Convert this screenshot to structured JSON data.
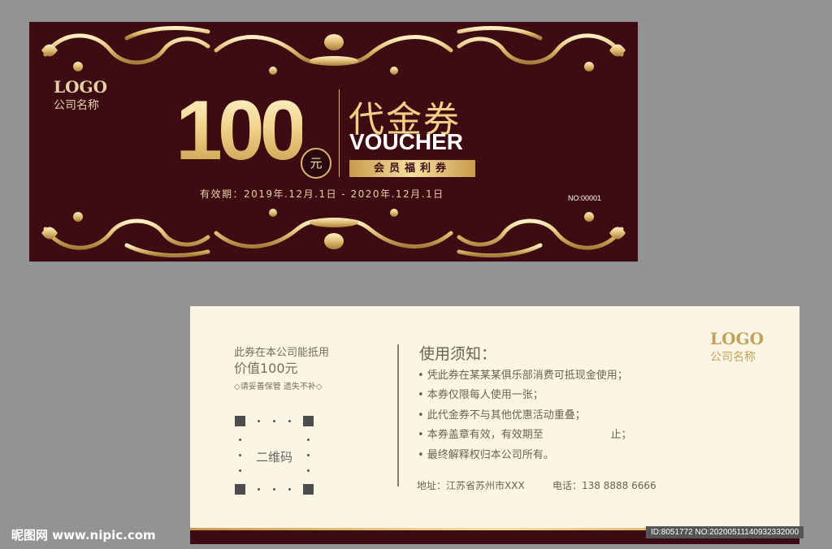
{
  "front": {
    "logo": "LOGO",
    "company": "公司名称",
    "amount": "100",
    "currency": "元",
    "title_cn": "代金券",
    "title_en": "VOUCHER",
    "member_label": "会员福利券",
    "validity": "有效期：2019年.12月.1日 - 2020年.12月.1日",
    "serial": "NO:00001",
    "colors": {
      "background": "#3d0b12",
      "gold": "#e8c97f"
    }
  },
  "back": {
    "stub_line1": "此券在本公司能抵用",
    "stub_line2": "价值100元",
    "stub_line3": "◇请妥善保管 遗失不补◇",
    "qr_label": "二维码",
    "rules_title": "使用须知：",
    "rules": [
      "• 凭此券在某某某俱乐部消费可抵现金使用；",
      "• 本券仅限每人使用一张；",
      "• 此代金券不与其他优惠活动重叠；",
      "• 本券盖章有效，有效期至                    止；",
      "• 最终解释权归本公司所有。"
    ],
    "address": "地址：江苏省苏州市XXX",
    "phone": "电话：138 8888 6666",
    "logo": "LOGO",
    "company": "公司名称",
    "colors": {
      "background": "#fbf6e3",
      "text": "#6e5f54"
    }
  },
  "watermark": {
    "left": "昵图网 www.nipic.com",
    "right": "ID:8051772 NO:20200511140932332000"
  }
}
